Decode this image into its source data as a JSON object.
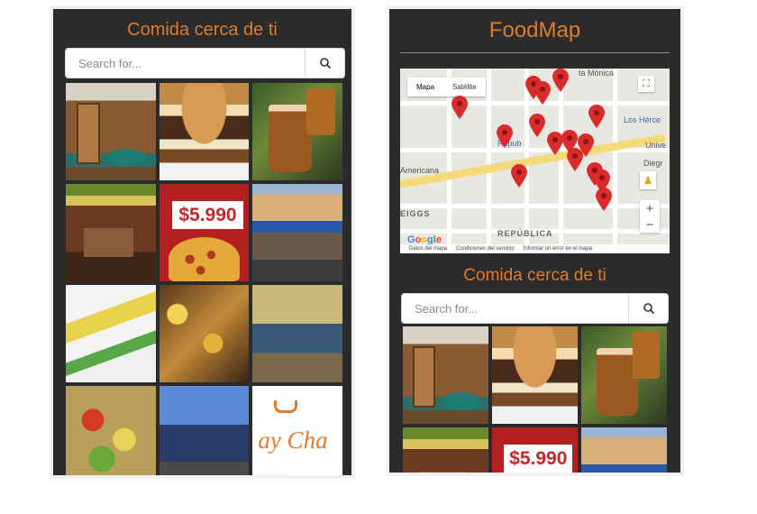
{
  "left_panel": {
    "title": "Comida cerca de ti",
    "search": {
      "placeholder": "Search for...",
      "value": ""
    },
    "tiles": [
      {
        "name": "restaurant-interior-photo"
      },
      {
        "name": "burger-photo"
      },
      {
        "name": "drink-photo"
      },
      {
        "name": "restaurant-fruit-photo"
      },
      {
        "name": "pizza-ad-photo",
        "price": "$5.990"
      },
      {
        "name": "storefront-photo"
      },
      {
        "name": "wrap-photo"
      },
      {
        "name": "food-crowd-photo"
      },
      {
        "name": "interior-photo"
      },
      {
        "name": "salad-photo"
      },
      {
        "name": "food-truck-photo"
      },
      {
        "name": "logo-photo",
        "logo_text": "ay Cha"
      }
    ]
  },
  "right_panel": {
    "app_title": "FoodMap",
    "map": {
      "map_type": [
        "Mapa",
        "Satélite"
      ],
      "labels": {
        "americana": "Americana",
        "repub": "Repub",
        "los_heroes": "Los Hérce",
        "republica": "REPÚBLICA",
        "eiggs": "EIGGS",
        "unive": "Unive",
        "diego": "Diegr",
        "monica": "ta Mónica",
        "zoom_in": "+",
        "zoom_out": "−"
      },
      "footer": [
        "Datos del mapa",
        "Condiciones del servicio",
        "Informar un error en el mapa"
      ],
      "google_logo": "Google",
      "marker_color": "#d92b2b"
    },
    "section_title": "Comida cerca de ti",
    "search": {
      "placeholder": "Search for...",
      "value": ""
    }
  },
  "accent_color": "#e07b2a"
}
